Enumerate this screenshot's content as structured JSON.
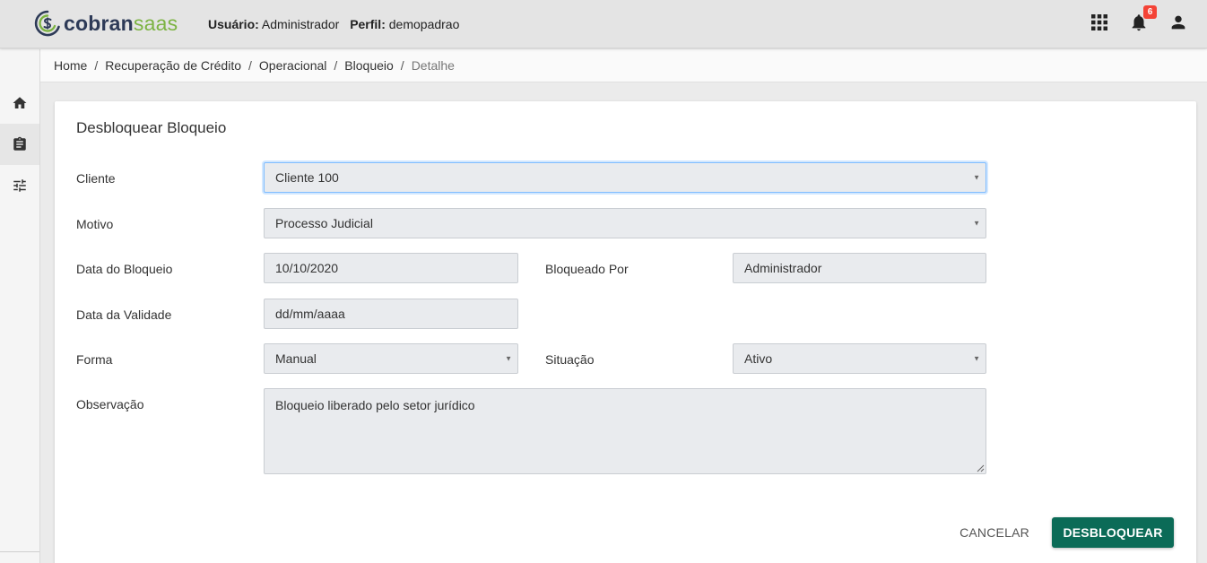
{
  "brand": {
    "part1": "cobran",
    "part2": "saas",
    "color_dark": "#2d3a57",
    "color_green": "#7cb342"
  },
  "header": {
    "user_label": "Usuário:",
    "user_value": "Administrador",
    "profile_label": "Perfil:",
    "profile_value": "demopadrao",
    "icons": [
      "apps-grid-icon",
      "bell-icon",
      "account-icon"
    ],
    "notification_count": "6"
  },
  "sidebar": {
    "items": [
      {
        "icon": "home-icon",
        "active": false
      },
      {
        "icon": "clipboard-icon",
        "active": true
      },
      {
        "icon": "sliders-icon",
        "active": false
      }
    ]
  },
  "breadcrumb": {
    "items": [
      "Home",
      "Recuperação de Crédito",
      "Operacional",
      "Bloqueio"
    ],
    "current": "Detalhe",
    "separator": "/"
  },
  "form": {
    "title": "Desbloquear Bloqueio",
    "cliente": {
      "label": "Cliente",
      "value": "Cliente 100"
    },
    "motivo": {
      "label": "Motivo",
      "value": "Processo Judicial"
    },
    "data_bloqueio": {
      "label": "Data do Bloqueio",
      "value": "10/10/2020"
    },
    "bloqueado_por": {
      "label": "Bloqueado Por",
      "value": "Administrador"
    },
    "data_validade": {
      "label": "Data da Validade",
      "value": "dd/mm/aaaa"
    },
    "forma": {
      "label": "Forma",
      "value": "Manual"
    },
    "situacao": {
      "label": "Situação",
      "value": "Ativo"
    },
    "observacao": {
      "label": "Observação",
      "value": "Bloqueio liberado pelo setor jurídico"
    }
  },
  "actions": {
    "cancel_label": "CANCELAR",
    "primary_label": "DESBLOQUEAR",
    "primary_color": "#0b6b57"
  }
}
